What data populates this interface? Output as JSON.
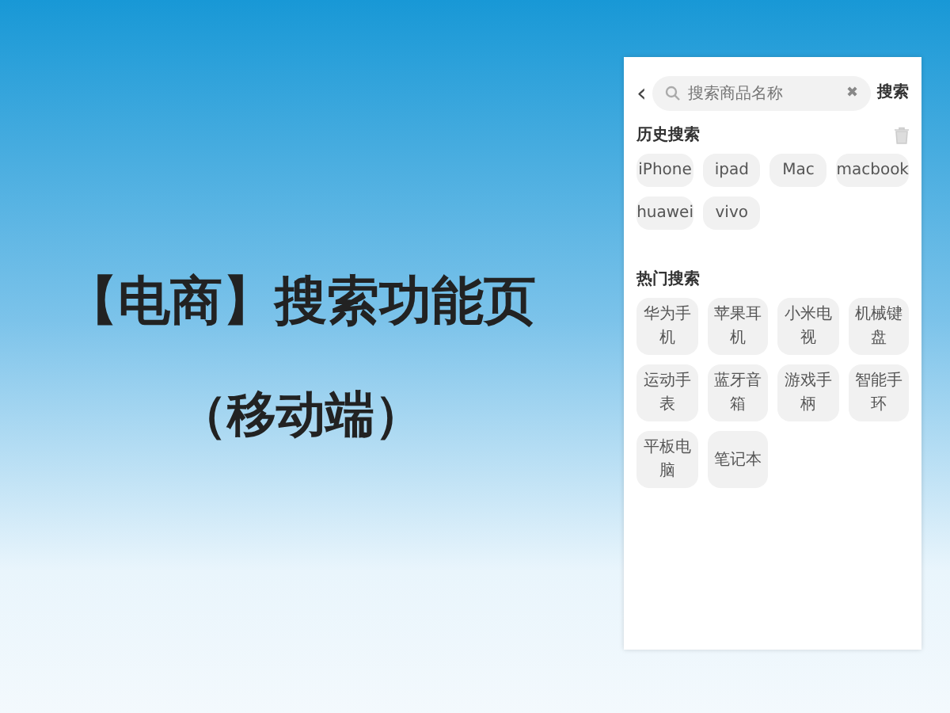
{
  "cover": {
    "title": "【电商】搜索功能页",
    "subtitle": "（移动端）"
  },
  "phone": {
    "back": "‹",
    "search": {
      "placeholder": "搜索商品名称"
    },
    "clear": "✖",
    "search_button": "搜索",
    "history": {
      "heading": "历史搜索",
      "items": [
        "iPhone",
        "ipad",
        "Mac",
        "macbook",
        "huawei",
        "vivo"
      ]
    },
    "hot": {
      "heading": "热门搜索",
      "items": [
        "华为手机",
        "苹果耳机",
        "小米电视",
        "机械键盘",
        "运动手表",
        "蓝牙音箱",
        "游戏手柄",
        "智能手环",
        "平板电脑",
        "笔记本"
      ]
    }
  }
}
